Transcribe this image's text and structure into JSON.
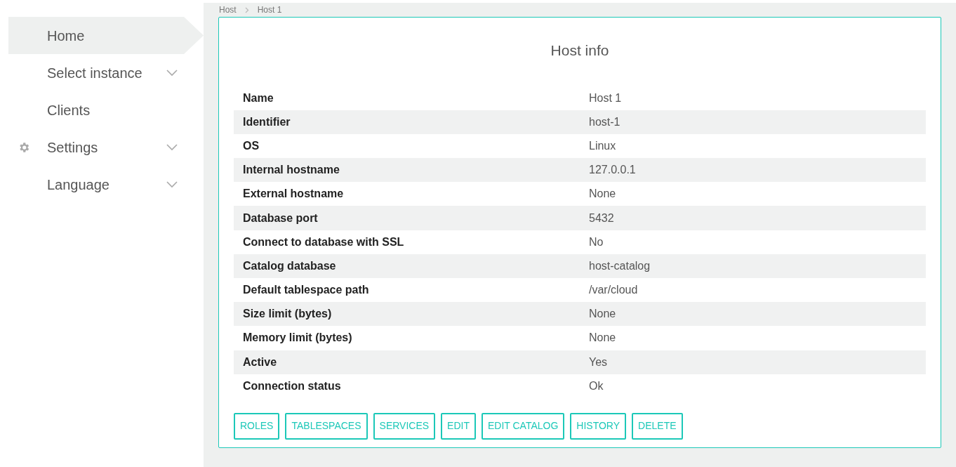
{
  "sidebar": {
    "items": [
      {
        "label": "Home",
        "selected": true,
        "kind": "plain",
        "expandable": false
      },
      {
        "label": "Select instance",
        "selected": false,
        "kind": "plain",
        "expandable": true
      },
      {
        "label": "Clients",
        "selected": false,
        "kind": "plain",
        "expandable": false
      },
      {
        "label": "Settings",
        "selected": false,
        "kind": "settings",
        "expandable": true
      },
      {
        "label": "Language",
        "selected": false,
        "kind": "plain",
        "expandable": true
      }
    ]
  },
  "breadcrumb": [
    "Host",
    "Host 1"
  ],
  "card": {
    "title": "Host info",
    "rows": [
      {
        "label": "Name",
        "value": "Host 1"
      },
      {
        "label": "Identifier",
        "value": "host-1"
      },
      {
        "label": "OS",
        "value": "Linux"
      },
      {
        "label": "Internal hostname",
        "value": "127.0.0.1"
      },
      {
        "label": "External hostname",
        "value": "None"
      },
      {
        "label": "Database port",
        "value": "5432"
      },
      {
        "label": "Connect to database with SSL",
        "value": "No"
      },
      {
        "label": "Catalog database",
        "value": "host-catalog"
      },
      {
        "label": "Default tablespace path",
        "value": "/var/cloud"
      },
      {
        "label": "Size limit (bytes)",
        "value": "None"
      },
      {
        "label": "Memory limit (bytes)",
        "value": "None"
      },
      {
        "label": "Active",
        "value": "Yes"
      },
      {
        "label": "Connection status",
        "value": "Ok"
      }
    ],
    "buttons": [
      "ROLES",
      "TABLESPACES",
      "SERVICES",
      "EDIT",
      "EDIT CATALOG",
      "HISTORY",
      "DELETE"
    ]
  }
}
